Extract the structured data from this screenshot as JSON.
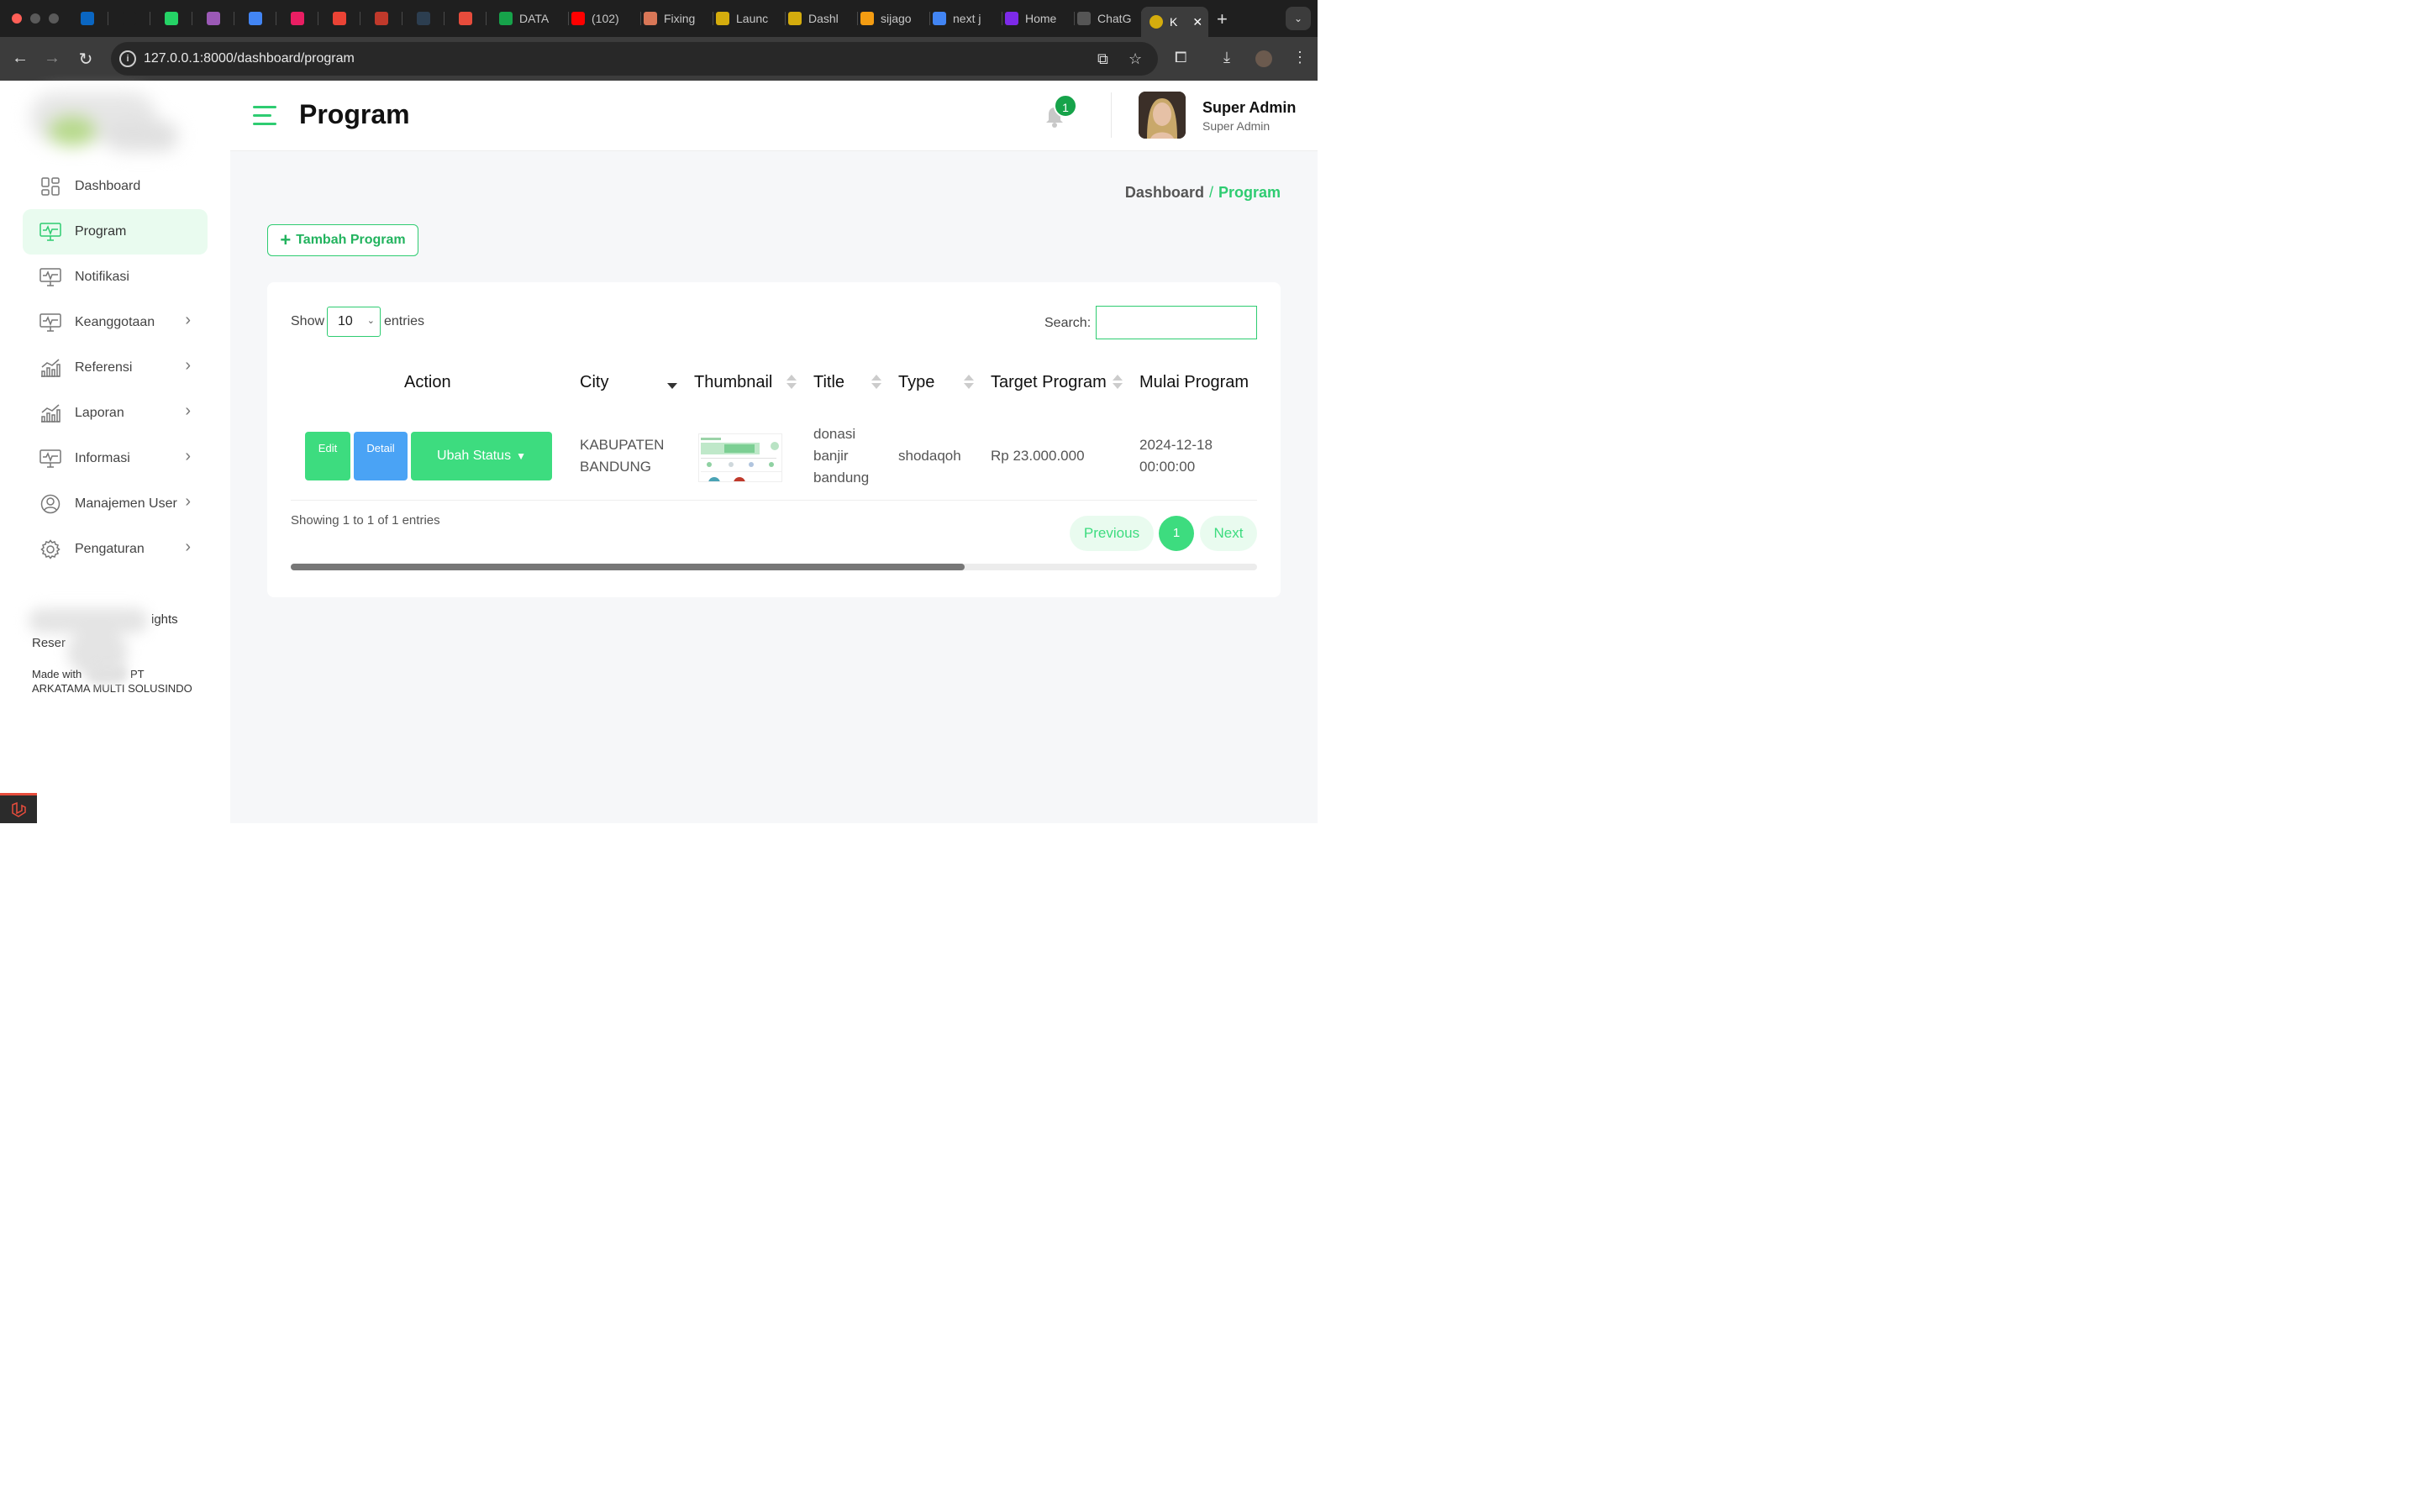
{
  "browser": {
    "tabs": [
      {
        "label": "",
        "fav": "linkedin-icon",
        "color": "#0a66c2"
      },
      {
        "label": "",
        "fav": "github-icon",
        "color": "#1f1f1f"
      },
      {
        "label": "",
        "fav": "whatsapp-icon",
        "color": "#25d366"
      },
      {
        "label": "",
        "fav": "trello-icon",
        "color": "#9b59b6"
      },
      {
        "label": "",
        "fav": "docs-icon",
        "color": "#4285f4"
      },
      {
        "label": "",
        "fav": "t-icon",
        "color": "#e91e63"
      },
      {
        "label": "",
        "fav": "gmail-icon",
        "color": "#ea4335"
      },
      {
        "label": "",
        "fav": "red-logo-icon",
        "color": "#c0392b"
      },
      {
        "label": "",
        "fav": "blue-logo-icon",
        "color": "#2c3e50"
      },
      {
        "label": "",
        "fav": "k-logo-icon",
        "color": "#e74c3c"
      },
      {
        "label": "DATA",
        "fav": "sheets-icon",
        "color": "#16a34a"
      },
      {
        "label": "(102)",
        "fav": "youtube-icon",
        "color": "#ff0000"
      },
      {
        "label": "Fixing",
        "fav": "claude-icon",
        "color": "#d97757"
      },
      {
        "label": "Launc",
        "fav": "emblem-icon",
        "color": "#d4ac0d"
      },
      {
        "label": "Dashl",
        "fav": "emblem-icon",
        "color": "#d4ac0d"
      },
      {
        "label": "sijago",
        "fav": "fire-icon",
        "color": "#f39c12"
      },
      {
        "label": "next j",
        "fav": "google-icon",
        "color": "#4285f4"
      },
      {
        "label": "Home",
        "fav": "canva-icon",
        "color": "#7d2ae8"
      },
      {
        "label": "ChatG",
        "fav": "openai-icon",
        "color": "#555555"
      }
    ],
    "active_tab": {
      "label": "K",
      "fav": "emblem-icon"
    },
    "url": "127.0.0.1:8000/dashboard/program"
  },
  "sidebar": {
    "items": [
      {
        "label": "Dashboard",
        "icon": "dashboard-grid-icon",
        "has_children": false,
        "active": false
      },
      {
        "label": "Program",
        "icon": "monitor-pulse-icon",
        "has_children": false,
        "active": true
      },
      {
        "label": "Notifikasi",
        "icon": "monitor-pulse-icon",
        "has_children": false,
        "active": false
      },
      {
        "label": "Keanggotaan",
        "icon": "monitor-pulse-icon",
        "has_children": true,
        "active": false
      },
      {
        "label": "Referensi",
        "icon": "chart-icon",
        "has_children": true,
        "active": false
      },
      {
        "label": "Laporan",
        "icon": "chart-icon",
        "has_children": true,
        "active": false
      },
      {
        "label": "Informasi",
        "icon": "monitor-pulse-icon",
        "has_children": true,
        "active": false
      },
      {
        "label": "Manajemen User",
        "icon": "user-circle-icon",
        "has_children": true,
        "active": false
      },
      {
        "label": "Pengaturan",
        "icon": "gear-icon",
        "has_children": true,
        "active": false
      }
    ],
    "footer_copyright": "ights",
    "footer_copyright_2": "Reser",
    "footer_made": "Made with",
    "footer_pt": "PT",
    "footer_company": "ARKATAMA MULTI SOLUSINDO"
  },
  "header": {
    "title": "Program",
    "notification_count": "1",
    "user_name": "Super Admin",
    "user_role": "Super Admin"
  },
  "breadcrumb": {
    "parent": "Dashboard",
    "separator": "/",
    "current": "Program"
  },
  "actions": {
    "add_label": "Tambah Program"
  },
  "table": {
    "show_label": "Show",
    "length_value": "10",
    "entries_label": "entries",
    "search_label": "Search:",
    "columns": [
      "Action",
      "City",
      "Thumbnail",
      "Title",
      "Type",
      "Target Program",
      "Mulai Program"
    ],
    "rows": [
      {
        "edit": "Edit",
        "detail": "Detail",
        "status": "Ubah Status",
        "city": "KABUPATEN BANDUNG",
        "title": "donasi banjir bandung",
        "type": "shodaqoh",
        "target": "Rp 23.000.000",
        "start": "2024-12-18 00:00:00"
      }
    ],
    "info": "Showing 1 to 1 of 1 entries",
    "prev_label": "Previous",
    "page": "1",
    "next_label": "Next"
  },
  "colors": {
    "accent": "#2ecc71",
    "accent_light": "#e9fbef",
    "info": "#4aa3f5",
    "badge": "#16a34a"
  }
}
